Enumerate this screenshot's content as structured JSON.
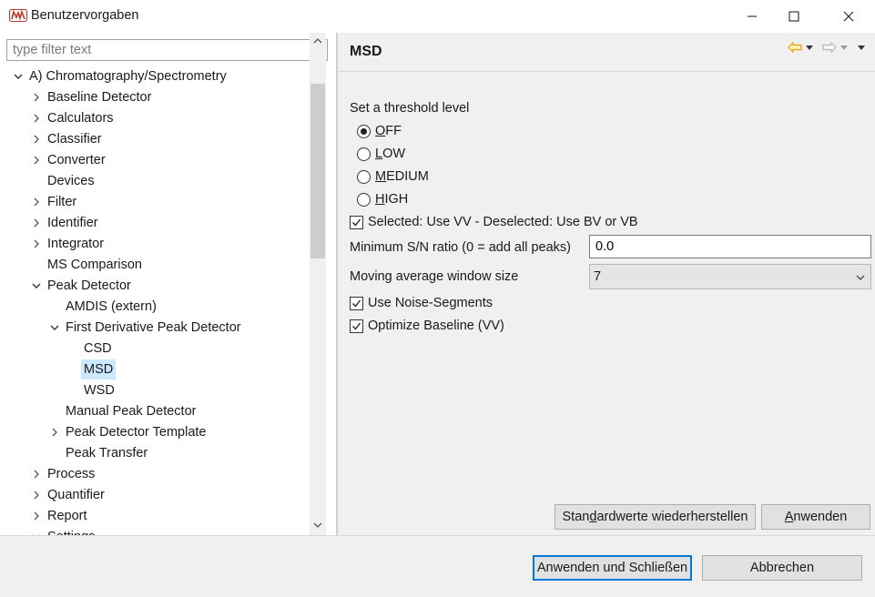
{
  "window": {
    "title": "Benutzervorgaben"
  },
  "filter": {
    "placeholder": "type filter text"
  },
  "tree": {
    "items": [
      {
        "label": "A) Chromatography/Spectrometry",
        "depth": 0,
        "state": "expanded"
      },
      {
        "label": "Baseline Detector",
        "depth": 1,
        "state": "collapsed"
      },
      {
        "label": "Calculators",
        "depth": 1,
        "state": "collapsed"
      },
      {
        "label": "Classifier",
        "depth": 1,
        "state": "collapsed"
      },
      {
        "label": "Converter",
        "depth": 1,
        "state": "collapsed"
      },
      {
        "label": "Devices",
        "depth": 1,
        "state": "leaf"
      },
      {
        "label": "Filter",
        "depth": 1,
        "state": "collapsed"
      },
      {
        "label": "Identifier",
        "depth": 1,
        "state": "collapsed"
      },
      {
        "label": "Integrator",
        "depth": 1,
        "state": "collapsed"
      },
      {
        "label": "MS Comparison",
        "depth": 1,
        "state": "leaf"
      },
      {
        "label": "Peak Detector",
        "depth": 1,
        "state": "expanded"
      },
      {
        "label": "AMDIS (extern)",
        "depth": 2,
        "state": "leaf"
      },
      {
        "label": "First Derivative Peak Detector",
        "depth": 2,
        "state": "expanded"
      },
      {
        "label": "CSD",
        "depth": 3,
        "state": "leaf"
      },
      {
        "label": "MSD",
        "depth": 3,
        "state": "leaf",
        "selected": true
      },
      {
        "label": "WSD",
        "depth": 3,
        "state": "leaf"
      },
      {
        "label": "Manual Peak Detector",
        "depth": 2,
        "state": "leaf"
      },
      {
        "label": "Peak Detector Template",
        "depth": 2,
        "state": "collapsed"
      },
      {
        "label": "Peak Transfer",
        "depth": 2,
        "state": "leaf"
      },
      {
        "label": "Process",
        "depth": 1,
        "state": "collapsed"
      },
      {
        "label": "Quantifier",
        "depth": 1,
        "state": "collapsed"
      },
      {
        "label": "Report",
        "depth": 1,
        "state": "collapsed"
      },
      {
        "label": "Settings",
        "depth": 1,
        "state": "expanded"
      }
    ]
  },
  "page": {
    "title": "MSD",
    "threshold_label": "Set a threshold level",
    "radios": [
      {
        "key": "O",
        "rest": "FF",
        "checked": true
      },
      {
        "key": "L",
        "rest": "OW",
        "checked": false
      },
      {
        "key": "M",
        "rest": "EDIUM",
        "checked": false
      },
      {
        "key": "H",
        "rest": "IGH",
        "checked": false
      }
    ],
    "vv_checkbox": {
      "label": "Selected: Use VV - Deselected: Use BV or VB",
      "checked": true
    },
    "sn_label": "Minimum S/N ratio (0 = add all peaks)",
    "sn_value": "0.0",
    "window_label": "Moving average window size",
    "window_value": "7",
    "noise_checkbox": {
      "label": "Use Noise-Segments",
      "checked": true
    },
    "baseline_checkbox": {
      "label": "Optimize Baseline (VV)",
      "checked": true
    },
    "restore_button": {
      "pre": "Stan",
      "key": "d",
      "post": "ardwerte wiederherstellen"
    },
    "apply_button": {
      "key": "A",
      "post": "nwenden"
    }
  },
  "footer": {
    "apply_close": "Anwenden und Schließen",
    "cancel": "Abbrechen"
  },
  "colors": {
    "selection": "#cce8ff",
    "nav_back": "#e8a000",
    "default_button_border": "#0078d7"
  }
}
